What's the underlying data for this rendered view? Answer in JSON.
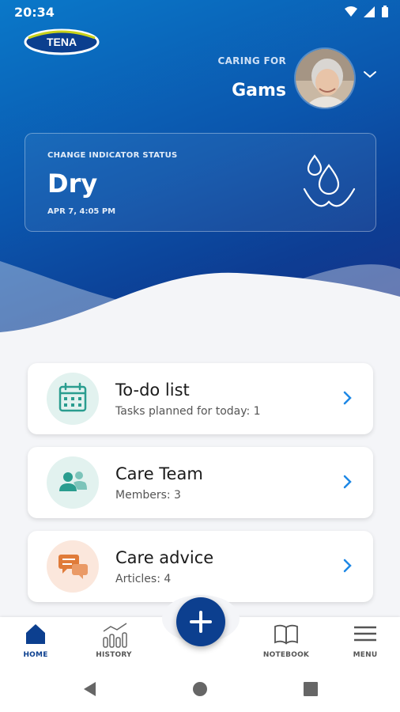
{
  "status_bar": {
    "time": "20:34"
  },
  "brand": {
    "logo_text": "TENA"
  },
  "caring": {
    "label": "CARING FOR",
    "name": "Gams"
  },
  "indicator": {
    "label": "CHANGE INDICATOR STATUS",
    "value": "Dry",
    "timestamp": "APR 7, 4:05 PM"
  },
  "cards": [
    {
      "title": "To-do list",
      "subtitle": "Tasks planned for today: 1",
      "icon": "calendar-icon"
    },
    {
      "title": "Care Team",
      "subtitle": "Members: 3",
      "icon": "people-icon"
    },
    {
      "title": "Care advice",
      "subtitle": "Articles: 4",
      "icon": "chat-icon"
    }
  ],
  "nav": {
    "home": "HOME",
    "history": "HISTORY",
    "notebook": "NOTEBOOK",
    "menu": "MENU"
  },
  "colors": {
    "primary": "#0c3f8f",
    "accent": "#1e88e5",
    "teal_icon": "#2a9d8f",
    "orange_icon": "#e07b39"
  }
}
